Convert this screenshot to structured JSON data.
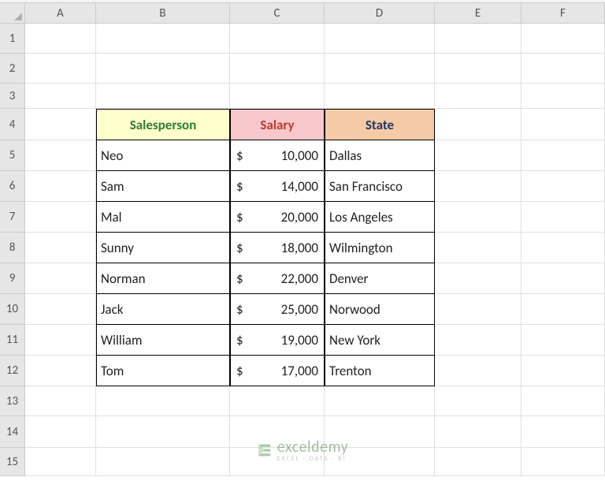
{
  "columns": [
    "A",
    "B",
    "C",
    "D",
    "E",
    "F"
  ],
  "rows": [
    "1",
    "2",
    "3",
    "4",
    "5",
    "6",
    "7",
    "8",
    "9",
    "10",
    "11",
    "12",
    "13",
    "14",
    "15"
  ],
  "table": {
    "headers": {
      "salesperson": "Salesperson",
      "salary": "Salary",
      "state": "State"
    },
    "currency_symbol": "$",
    "data": [
      {
        "salesperson": "Neo",
        "salary": "10,000",
        "state": "Dallas"
      },
      {
        "salesperson": "Sam",
        "salary": "14,000",
        "state": "San Francisco"
      },
      {
        "salesperson": "Mal",
        "salary": "20,000",
        "state": "Los Angeles"
      },
      {
        "salesperson": "Sunny",
        "salary": "18,000",
        "state": "Wilmington"
      },
      {
        "salesperson": "Norman",
        "salary": "22,000",
        "state": "Denver"
      },
      {
        "salesperson": "Jack",
        "salary": "25,000",
        "state": "Norwood"
      },
      {
        "salesperson": "William",
        "salary": "19,000",
        "state": "New York"
      },
      {
        "salesperson": "Tom",
        "salary": "17,000",
        "state": "Trenton"
      }
    ]
  },
  "watermark": {
    "brand": "exceldemy",
    "tagline": "EXCEL · DATA · BI"
  },
  "chart_data": {
    "type": "table",
    "columns": [
      "Salesperson",
      "Salary",
      "State"
    ],
    "rows": [
      [
        "Neo",
        10000,
        "Dallas"
      ],
      [
        "Sam",
        14000,
        "San Francisco"
      ],
      [
        "Mal",
        20000,
        "Los Angeles"
      ],
      [
        "Sunny",
        18000,
        "Wilmington"
      ],
      [
        "Norman",
        22000,
        "Denver"
      ],
      [
        "Jack",
        25000,
        "Norwood"
      ],
      [
        "William",
        19000,
        "New York"
      ],
      [
        "Tom",
        17000,
        "Trenton"
      ]
    ]
  }
}
